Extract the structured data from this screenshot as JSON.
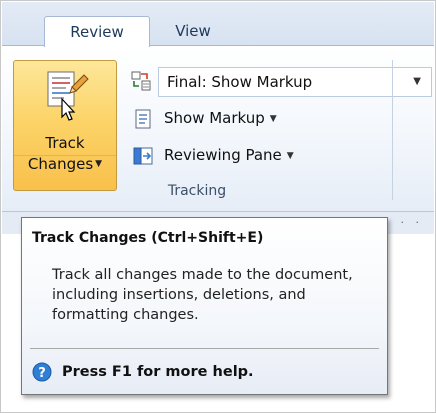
{
  "tabs": [
    {
      "label": "Review",
      "active": true
    },
    {
      "label": "View",
      "active": false
    }
  ],
  "ribbon": {
    "track_changes": {
      "line1": "Track",
      "line2": "Changes"
    },
    "markup_select": {
      "value": "Final: Show Markup"
    },
    "show_markup": "Show Markup",
    "reviewing_pane": "Reviewing Pane",
    "group_label": "Tracking"
  },
  "tooltip": {
    "title": "Track Changes (Ctrl+Shift+E)",
    "body": "Track all changes made to the document, including insertions, deletions, and formatting changes.",
    "help": "Press F1 for more help."
  },
  "colors": {
    "active_button": "#f9c04b",
    "help_icon": "#2f7fd4",
    "tab_text": "#1e395b"
  }
}
